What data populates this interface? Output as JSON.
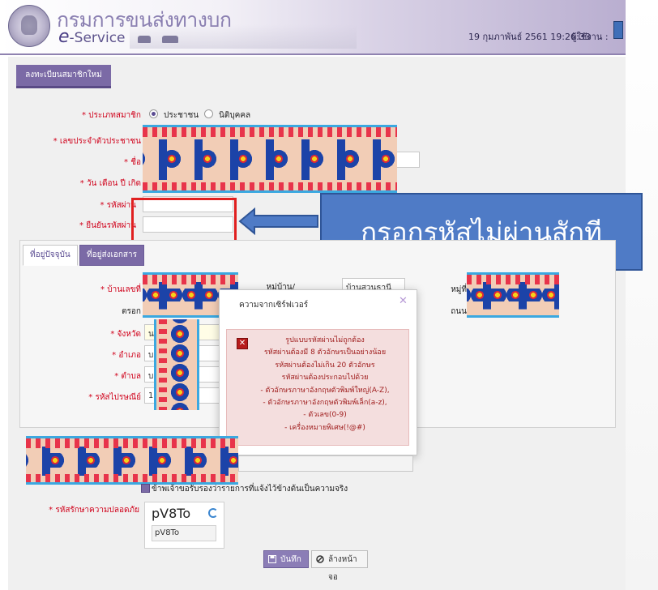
{
  "header": {
    "brand_th": "กรมการขนส่งทางบก",
    "brand_en_e": "e",
    "brand_en_rest": "-Service",
    "datetime": "19 กุมภาพันธ์ 2561 19:26:33",
    "user_label": "ผู้ใช้งาน :"
  },
  "page_title": "ลงทะเบียนสมาชิกใหม่",
  "form": {
    "member_type_label": "* ประเภทสมาชิก",
    "member_type_options": [
      "ประชาชน",
      "นิติบุคคล"
    ],
    "member_type_selected": "ประชาชน",
    "id_label": "* เลขประจำตัวประชาชน",
    "name_label": "* ชื่อ",
    "dob_label": "* วัน เดือน ปี เกิด",
    "password_label": "* รหัสผ่าน",
    "confirm_password_label": "* ยืนยันรหัสผ่าน"
  },
  "annotation": {
    "callout_text": "กรอกรหัสไม่ผ่านสักที"
  },
  "tabs": [
    "ที่อยู่ปัจจุบัน",
    "ที่อยู่ส่งเอกสาร"
  ],
  "address": {
    "house_no_label": "* บ้านเลขที่",
    "village_label": "หมู่บ้าน/อาคาร",
    "village_value": "บ้านสวนธานี",
    "moo_label": "หมู่ที่",
    "soi_label": "ตรอก",
    "road_label": "ถนน",
    "province_label": "* จังหวัด",
    "province_value": "น",
    "district_label": "* อำเภอ",
    "district_value": "บ",
    "subdistrict_label": "* ตำบล",
    "subdistrict_value": "บ",
    "postcode_label": "* รหัสไปรษณีย์",
    "postcode_value": "1"
  },
  "dialog": {
    "title": "ความจากเซิร์ฟเวอร์",
    "messages": [
      "รูปแบบรหัสผ่านไม่ถูกต้อง",
      "รหัสผ่านต้องมี 8 ตัวอักษรเป็นอย่างน้อย",
      "รหัสผ่านต้องไม่เกิน 20 ตัวอักษร",
      "รหัสผ่านต้องประกอบไปด้วย",
      "- ตัวอักษรภาษาอังกฤษตัวพิมพ์ใหญ่(A-Z),",
      "- ตัวอักษรภาษาอังกฤษตัวพิมพ์เล็ก(a-z),",
      "- ตัวเลข(0-9)",
      "- เครื่องหมายพิเศษ(!@#)"
    ]
  },
  "confirm_text": "ข้าพเจ้าขอรับรองว่ารายการที่แจ้งไว้ข้างต้นเป็นความจริง",
  "captcha": {
    "label": "* รหัสรักษาความปลอดภัย",
    "code": "pV8To",
    "input_value": "pV8To"
  },
  "buttons": {
    "save": "บันทึก",
    "clear": "ล้างหน้าจอ"
  }
}
